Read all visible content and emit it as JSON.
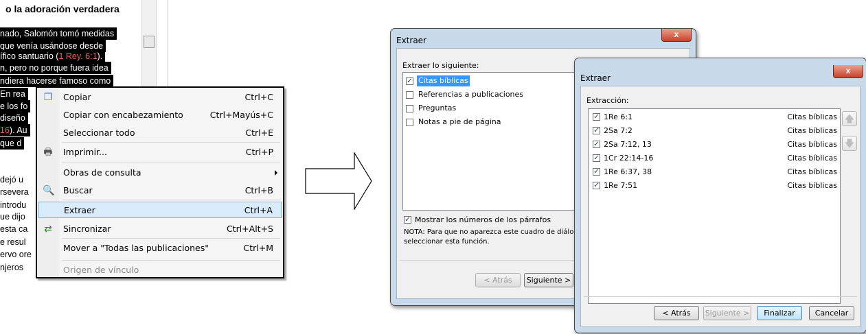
{
  "document": {
    "heading": "o la adoración verdadera",
    "lines": [
      {
        "text": "nado, Salomón tomó medidas",
        "selected": true
      },
      {
        "text": "que venía usándose desde",
        "selected": true
      },
      {
        "text": "ífico santuario (",
        "ref": "1 Rey. 6:1",
        "after": ").",
        "selected": true
      },
      {
        "text": "n, pero no porque fuera idea",
        "selected": true
      },
      {
        "text": "ndiera hacerse famoso como",
        "selected": true
      },
      {
        "text": "En rea",
        "selected": true
      },
      {
        "text": "e los fo",
        "selected": true
      },
      {
        "text": "diseño",
        "selected": true
      },
      {
        "text": "",
        "ref": "16",
        "after": "). Au",
        "selected": true
      },
      {
        "text": " que d",
        "selected": true
      },
      {
        "text": "dejó u",
        "selected": false
      },
      {
        "text": "rsevera",
        "selected": false
      },
      {
        "text": " introdu",
        "selected": false
      },
      {
        "text": "ue dijo",
        "selected": false
      },
      {
        "text": "esta ca",
        "selected": false
      },
      {
        "text": "e resul",
        "selected": false
      },
      {
        "text": "ervo ore",
        "selected": false
      },
      {
        "text": "njeros",
        "selected": false
      }
    ]
  },
  "context_menu": {
    "items": [
      {
        "label": "Copiar",
        "shortcut": "Ctrl+C",
        "icon": "copy-icon",
        "glyph": "❐"
      },
      {
        "label": "Copiar con encabezamiento",
        "shortcut": "Ctrl+Mayús+C"
      },
      {
        "label": "Seleccionar todo",
        "shortcut": "Ctrl+E"
      },
      {
        "label": "Imprimir...",
        "shortcut": "Ctrl+P",
        "icon": "printer-icon",
        "glyph": "🖶"
      },
      {
        "label": "Obras de consulta",
        "shortcut": ""
      },
      {
        "label": "Buscar",
        "shortcut": "Ctrl+B",
        "icon": "search-icon",
        "glyph": "🔍"
      },
      {
        "label": "Extraer",
        "shortcut": "Ctrl+A"
      },
      {
        "label": "Sincronizar",
        "shortcut": "Ctrl+Alt+S",
        "icon": "sync-icon",
        "glyph": "⇄"
      },
      {
        "label": "Mover a \"Todas las publicaciones\"",
        "shortcut": "Ctrl+M"
      },
      {
        "label": "Origen de vínculo",
        "shortcut": ""
      }
    ],
    "highlighted": "Extraer",
    "disabled": "Origen de vínculo"
  },
  "dialog1": {
    "title": "Extraer",
    "close": "x",
    "section_label": "Extraer lo siguiente:",
    "options": [
      {
        "label": "Citas bíblicas",
        "checked": true
      },
      {
        "label": "Referencias a publicaciones",
        "checked": false
      },
      {
        "label": "Preguntas",
        "checked": false
      },
      {
        "label": "Notas a pie de página",
        "checked": false
      }
    ],
    "show_paragraphs_label": "Mostrar los números de los párrafos",
    "note_line1": "NOTA: Para que no aparezca este cuadro de diálogo",
    "note_line2": "seleccionar esta función.",
    "back_button": "< Atrás",
    "next_button": "Siguiente >"
  },
  "dialog2": {
    "title": "Extraer",
    "close": "x",
    "section_label": "Extracción:",
    "rows": [
      {
        "ref": "1Re 6:1",
        "type": "Citas bíblicas"
      },
      {
        "ref": "2Sa 7:2",
        "type": "Citas bíblicas"
      },
      {
        "ref": "2Sa 7:12, 13",
        "type": "Citas bíblicas"
      },
      {
        "ref": "1Cr 22:14-16",
        "type": "Citas bíblicas"
      },
      {
        "ref": "1Re 6:37, 38",
        "type": "Citas bíblicas"
      },
      {
        "ref": "1Re 7:51",
        "type": "Citas bíblicas"
      }
    ],
    "back_button": "< Atrás",
    "next_button": "Siguiente >",
    "finish_button": "Finalizar",
    "cancel_button": "Cancelar"
  }
}
